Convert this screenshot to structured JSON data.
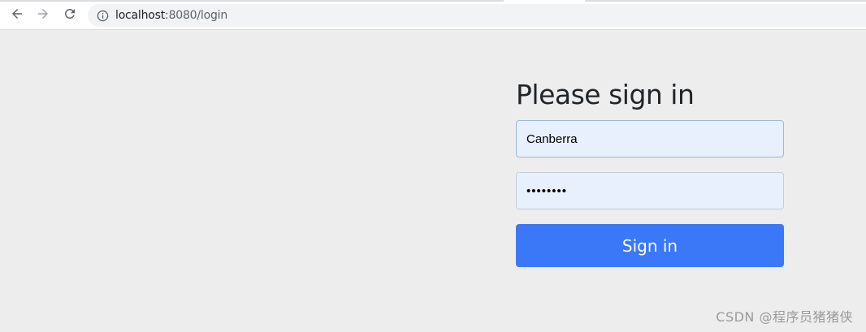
{
  "browser": {
    "url_host": "localhost",
    "url_rest": ":8080/login",
    "icons": {
      "back": "back-arrow-icon",
      "forward": "forward-arrow-icon",
      "reload": "reload-icon",
      "info": "info-icon"
    }
  },
  "login": {
    "heading": "Please sign in",
    "username_value": "Canberra",
    "password_value": "••••••••",
    "submit_label": "Sign in"
  },
  "watermark": "CSDN @程序员猪猪侠",
  "colors": {
    "page_background": "#ededed",
    "button": "#3b78f7",
    "autofill_background": "#e8f0fe"
  }
}
